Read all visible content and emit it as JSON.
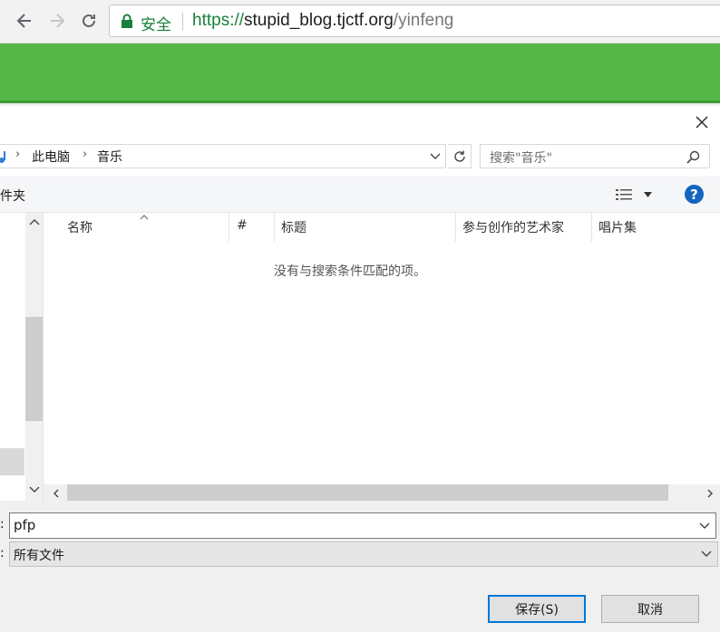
{
  "browser": {
    "secure_label": "安全",
    "url_scheme": "https://",
    "url_host": "stupid_blog.tjctf.org",
    "url_path": "/yinfeng"
  },
  "dialog": {
    "breadcrumbs": [
      "此电脑",
      "音乐"
    ],
    "search_placeholder": "搜索\"音乐\"",
    "toolbar": {
      "new_folder_label": "件夹",
      "help_label": "?"
    },
    "columns": [
      "名称",
      "#",
      "标题",
      "参与创作的艺术家",
      "唱片集"
    ],
    "empty_message": "没有与搜索条件匹配的项。",
    "filename": {
      "label": ":",
      "value": "pfp"
    },
    "filetype": {
      "label": ":",
      "value": "所有文件"
    },
    "save_label": "保存(S)",
    "cancel_label": "取消"
  },
  "colors": {
    "accent_green": "#56b947",
    "secure_green": "#188038",
    "focus_blue": "#0078d7"
  }
}
